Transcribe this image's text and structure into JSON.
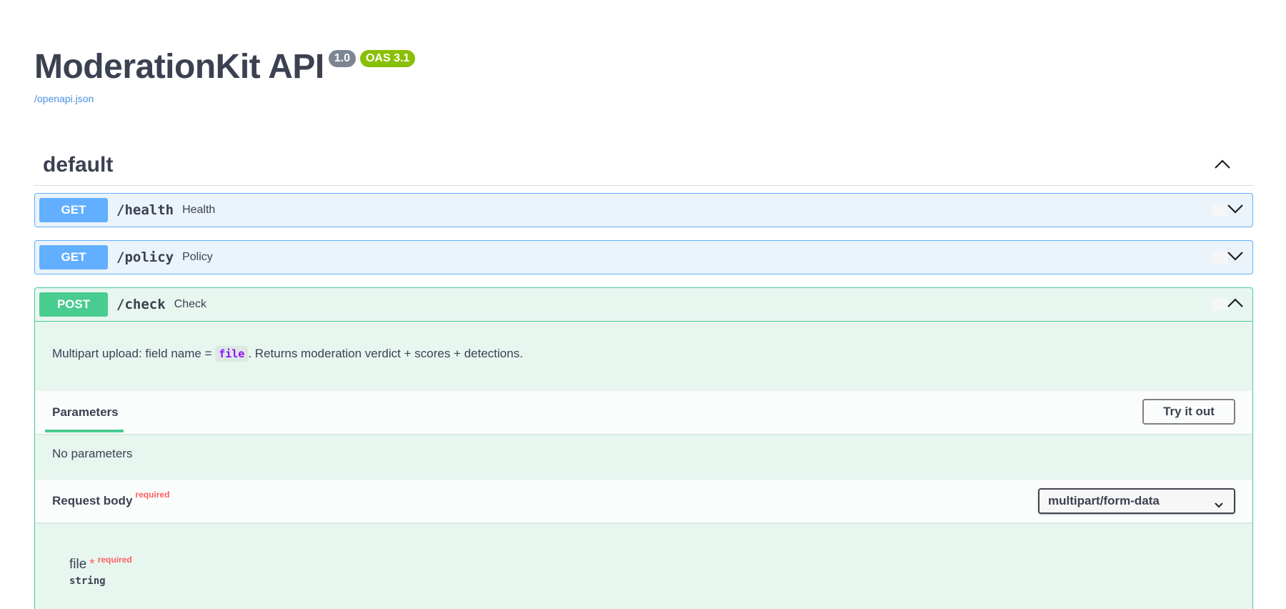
{
  "info": {
    "title": "ModerationKit API",
    "version": "1.0",
    "oas": "OAS 3.1",
    "spec_link": "/openapi.json"
  },
  "tag": {
    "name": "default",
    "toggle_icon": "chevron-up-icon"
  },
  "operations": [
    {
      "method": "GET",
      "path": "/health",
      "summary": "Health",
      "expanded": false
    },
    {
      "method": "GET",
      "path": "/policy",
      "summary": "Policy",
      "expanded": false
    },
    {
      "method": "POST",
      "path": "/check",
      "summary": "Check",
      "expanded": true,
      "description": {
        "before": "Multipart upload: field name = ",
        "code": "file",
        "after": ". Returns moderation verdict + scores + detections."
      },
      "parameters": {
        "tab_label": "Parameters",
        "try_button": "Try it out",
        "empty_text": "No parameters"
      },
      "request_body": {
        "label": "Request body",
        "required_flag": "required",
        "content_type": "multipart/form-data",
        "fields": [
          {
            "name": "file",
            "star": "*",
            "required_flag": "required",
            "type": "string"
          }
        ]
      }
    }
  ],
  "colors": {
    "get": "#61affe",
    "post": "#49cc90",
    "required": "#ff6060",
    "link": "#4990e2"
  }
}
